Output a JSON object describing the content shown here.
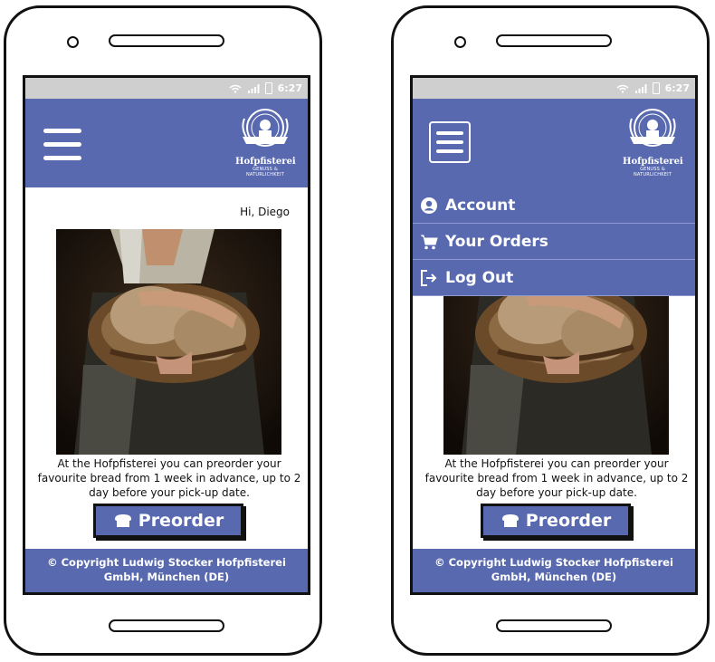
{
  "status_bar": {
    "time": "6:27"
  },
  "brand": {
    "name": "Hofpfisterei",
    "tagline": "GENUSS & NATURLICHKEIT"
  },
  "greeting": "Hi, Diego",
  "description": "At the Hofpfisterei you can preorder your favourite bread from 1 week in advance, up to 2 day before your pick-up date.",
  "preorder_button": {
    "label": "Preorder",
    "icon": "bread-icon"
  },
  "footer": {
    "line1": "© Copyright Ludwig Stocker Hofpfisterei",
    "line2": "GmbH, München (DE)"
  },
  "menu": {
    "items": [
      {
        "label": "Account",
        "icon": "user-circle-icon"
      },
      {
        "label": "Your Orders",
        "icon": "cart-icon"
      },
      {
        "label": "Log Out",
        "icon": "logout-icon"
      }
    ]
  },
  "colors": {
    "brand_blue": "#5869b0",
    "status_bar": "#cfcfcf"
  }
}
